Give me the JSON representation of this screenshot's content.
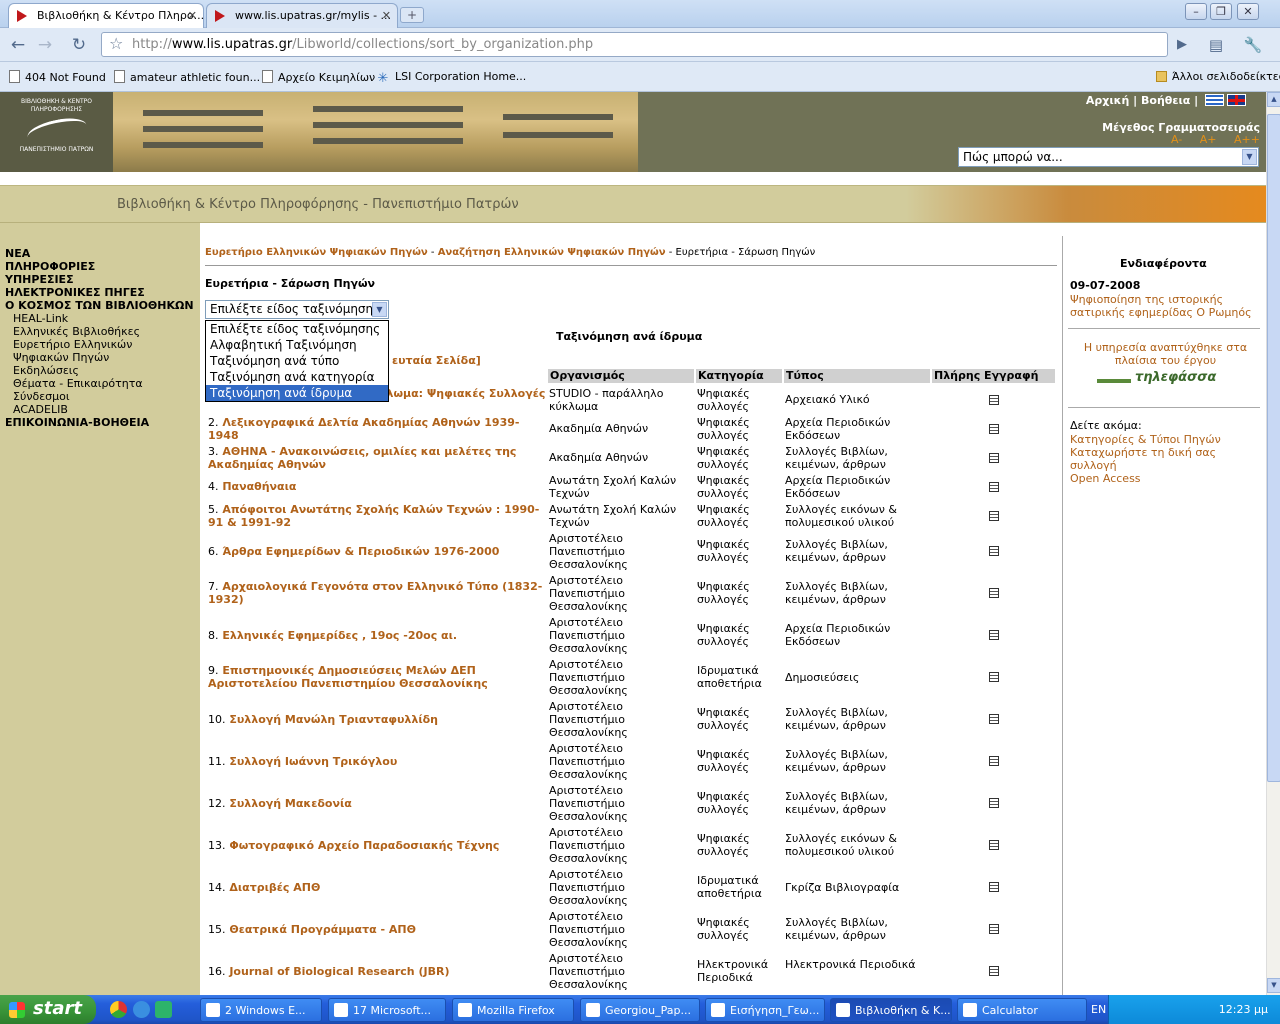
{
  "browser": {
    "tabs": [
      {
        "label": "Βιβλιοθήκη & Κέντρο Πληρο..."
      },
      {
        "label": "www.lis.upatras.gr/mylis - ..."
      }
    ],
    "url_prefix": "http://",
    "url_host": "www.lis.upatras.gr",
    "url_path": "/Libworld/collections/sort_by_organization.php",
    "bookmarks": [
      "404 Not Found",
      "amateur athletic foun...",
      "Αρχείο Κειμηλίων",
      "LSI Corporation Home..."
    ],
    "other_bookmarks": "Άλλοι σελιδοδείκτες"
  },
  "header": {
    "logo_text": "ΒΙΒΛΙΟΘΗΚΗ & ΚΕΝΤΡΟ ΠΛΗΡΟΦΟΡΗΣΗΣ",
    "logo_bottom": "ΠΑΝΕΠΙΣΤΗΜΙΟ ΠΑΤΡΩΝ",
    "home": "Αρχική",
    "help": "Βοήθεια",
    "font_size_label": "Μέγεθος Γραμματοσειράς",
    "font_small": "A-",
    "font_medium": "A+",
    "font_large": "A++",
    "howto_value": "Πώς μπορώ να..."
  },
  "banner": {
    "title": "Βιβλιοθήκη & Κέντρο Πληροφόρησης - Πανεπιστήμιο Πατρών"
  },
  "leftnav": [
    {
      "label": "ΝΕΑ",
      "bold": true
    },
    {
      "label": "ΠΛΗΡΟΦΟΡΙΕΣ",
      "bold": true
    },
    {
      "label": "ΥΠΗΡΕΣΙΕΣ",
      "bold": true
    },
    {
      "label": "ΗΛΕΚΤΡΟΝΙΚΕΣ ΠΗΓΕΣ",
      "bold": true
    },
    {
      "label": "Ο ΚΟΣΜΟΣ ΤΩΝ ΒΙΒΛΙΟΘΗΚΩΝ",
      "bold": true
    },
    {
      "label": "HEAL-Link",
      "bold": false
    },
    {
      "label": "Ελληνικές Βιβλιοθήκες",
      "bold": false
    },
    {
      "label": "Ευρετήριο Ελληνικών",
      "bold": false
    },
    {
      "label": "Ψηφιακών Πηγών",
      "bold": false
    },
    {
      "label": "Εκδηλώσεις",
      "bold": false
    },
    {
      "label": "Θέματα - Επικαιρότητα",
      "bold": false
    },
    {
      "label": "Σύνδεσμοι",
      "bold": false
    },
    {
      "label": "ACADELIB",
      "bold": false
    },
    {
      "label": "ΕΠΙΚΟΙΝΩΝΙΑ-ΒΟΗΘΕΙΑ",
      "bold": true
    }
  ],
  "breadcrumb": {
    "link1": "Ευρετήριο Ελληνικών Ψηφιακών Πηγών",
    "link2": "Αναζήτηση Ελληνικών Ψηφιακών Πηγών",
    "current": "Ευρετήρια - Σάρωση Πηγών",
    "sep": " - "
  },
  "main": {
    "section_title": "Ευρετήρια - Σάρωση Πηγών",
    "sort_selected": "Επιλέξτε είδος ταξινόμησης",
    "sort_options": [
      "Επιλέξτε είδος ταξινόμησης",
      "Αλφαβητική Ταξινόμηση",
      "Ταξινόμηση ανά τύπο",
      "Ταξινόμηση ανά κατηγορία",
      "Ταξινόμηση ανά ίδρυμα"
    ],
    "list_heading": "Ταξινόμηση ανά ίδρυμα",
    "last_page": "ευταία Σελίδα]"
  },
  "table": {
    "headers": [
      "Οργανισμός",
      "Κατηγορία",
      "Τύπος",
      "Πλήρης Εγγραφή"
    ],
    "rows": [
      {
        "num": "1.",
        "title": "Στούντιο - Παράλληλο Κύκλωμα: Ψηφιακές Συλλογές",
        "org": "STUDIO - παράλληλο κύκλωμα",
        "cat": "Ψηφιακές συλλογές",
        "type": "Αρχειακό Υλικό"
      },
      {
        "num": "2.",
        "title": "Λεξικογραφικά Δελτία Ακαδημίας Αθηνών 1939-1948",
        "org": "Ακαδημία Αθηνών",
        "cat": "Ψηφιακές συλλογές",
        "type": "Αρχεία Περιοδικών Εκδόσεων"
      },
      {
        "num": "3.",
        "title": "ΑΘΗΝΑ - Ανακοινώσεις, ομιλίες και μελέτες της Ακαδημίας Αθηνών",
        "org": "Ακαδημία Αθηνών",
        "cat": "Ψηφιακές συλλογές",
        "type": "Συλλογές Βιβλίων, κειμένων, άρθρων"
      },
      {
        "num": "4.",
        "title": "Παναθήναια",
        "org": "Ανωτάτη Σχολή Καλών Τεχνών",
        "cat": "Ψηφιακές συλλογές",
        "type": "Αρχεία Περιοδικών Εκδόσεων"
      },
      {
        "num": "5.",
        "title": "Απόφοιτοι Ανωτάτης Σχολής Καλών Τεχνών : 1990-91 & 1991-92",
        "org": "Ανωτάτη Σχολή Καλών Τεχνών",
        "cat": "Ψηφιακές συλλογές",
        "type": "Συλλογές εικόνων & πολυμεσικού υλικού"
      },
      {
        "num": "6.",
        "title": "Άρθρα Εφημερίδων & Περιοδικών 1976-2000",
        "org": "Αριστοτέλειο Πανεπιστήμιο Θεσσαλονίκης",
        "cat": "Ψηφιακές συλλογές",
        "type": "Συλλογές Βιβλίων, κειμένων, άρθρων"
      },
      {
        "num": "7.",
        "title": "Αρχαιολογικά Γεγονότα στον Ελληνικό Τύπο (1832-1932)",
        "org": "Αριστοτέλειο Πανεπιστήμιο Θεσσαλονίκης",
        "cat": "Ψηφιακές συλλογές",
        "type": "Συλλογές Βιβλίων, κειμένων, άρθρων"
      },
      {
        "num": "8.",
        "title": "Ελληνικές Εφημερίδες , 19ος -20ος αι.",
        "org": "Αριστοτέλειο Πανεπιστήμιο Θεσσαλονίκης",
        "cat": "Ψηφιακές συλλογές",
        "type": "Αρχεία Περιοδικών Εκδόσεων"
      },
      {
        "num": "9.",
        "title": "Επιστημονικές Δημοσιεύσεις Μελών ΔΕΠ Αριστοτελείου Πανεπιστημίου Θεσσαλονίκης",
        "org": "Αριστοτέλειο Πανεπιστήμιο Θεσσαλονίκης",
        "cat": "Ιδρυματικά αποθετήρια",
        "type": "Δημοσιεύσεις"
      },
      {
        "num": "10.",
        "title": "Συλλογή Μανώλη Τριανταφυλλίδη",
        "org": "Αριστοτέλειο Πανεπιστήμιο Θεσσαλονίκης",
        "cat": "Ψηφιακές συλλογές",
        "type": "Συλλογές Βιβλίων, κειμένων, άρθρων"
      },
      {
        "num": "11.",
        "title": "Συλλογή Ιωάννη Τρικόγλου",
        "org": "Αριστοτέλειο Πανεπιστήμιο Θεσσαλονίκης",
        "cat": "Ψηφιακές συλλογές",
        "type": "Συλλογές Βιβλίων, κειμένων, άρθρων"
      },
      {
        "num": "12.",
        "title": "Συλλογή Μακεδονία",
        "org": "Αριστοτέλειο Πανεπιστήμιο Θεσσαλονίκης",
        "cat": "Ψηφιακές συλλογές",
        "type": "Συλλογές Βιβλίων, κειμένων, άρθρων"
      },
      {
        "num": "13.",
        "title": "Φωτογραφικό Αρχείο Παραδοσιακής Τέχνης",
        "org": "Αριστοτέλειο Πανεπιστήμιο Θεσσαλονίκης",
        "cat": "Ψηφιακές συλλογές",
        "type": "Συλλογές εικόνων & πολυμεσικού υλικού"
      },
      {
        "num": "14.",
        "title": "Διατριβές ΑΠΘ",
        "org": "Αριστοτέλειο Πανεπιστήμιο Θεσσαλονίκης",
        "cat": "Ιδρυματικά αποθετήρια",
        "type": "Γκρίζα Βιβλιογραφία"
      },
      {
        "num": "15.",
        "title": "Θεατρικά Προγράμματα - ΑΠΘ",
        "org": "Αριστοτέλειο Πανεπιστήμιο Θεσσαλονίκης",
        "cat": "Ψηφιακές συλλογές",
        "type": "Συλλογές Βιβλίων, κειμένων, άρθρων"
      },
      {
        "num": "16.",
        "title": "Journal of Biological Research (JBR)",
        "org": "Αριστοτέλειο Πανεπιστήμιο Θεσσαλονίκης",
        "cat": "Ηλεκτρονικά Περιοδικά",
        "type": "Ηλεκτρονικά Περιοδικά"
      }
    ]
  },
  "rightcol": {
    "heading": "Ενδιαφέροντα",
    "date": "09-07-2008",
    "news": "Ψηφιοποίηση της ιστορικής σατιρικής εφημερίδας Ο Ρωμηός",
    "dev_text": "Η υπηρεσία αναπτύχθηκε στα πλαίσια του έργου",
    "project_logo": "τηλεφάσσα",
    "see_also": "Δείτε ακόμα:",
    "links": [
      "Κατηγορίες & Τύποι Πηγών",
      "Καταχωρήστε τη δική σας συλλογή",
      "Open Access"
    ]
  },
  "taskbar": {
    "start": "start",
    "tasks": [
      "2 Windows E...",
      "17 Microsoft...",
      "Mozilla Firefox",
      "Georgiou_Pap...",
      "Εισήγηση_Γεω...",
      "Βιβλιοθήκη & Κ...",
      "Calculator"
    ],
    "lang": "EN",
    "clock": "12:23 μμ"
  }
}
